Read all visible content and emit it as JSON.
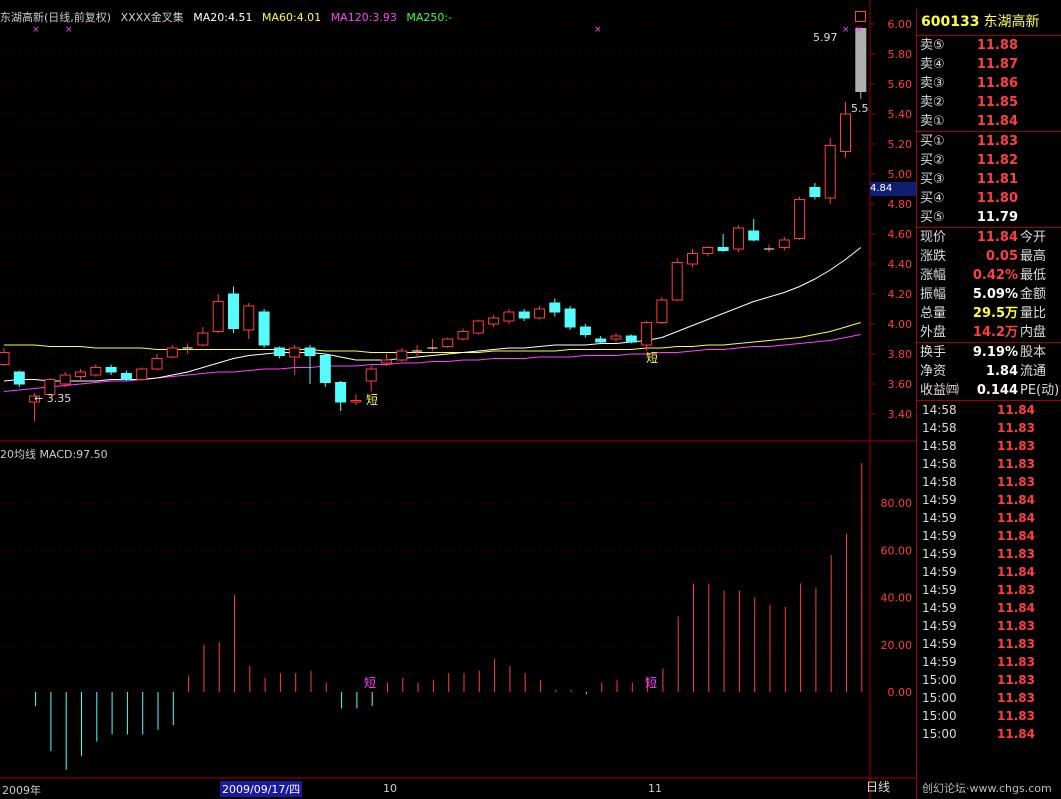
{
  "header": {
    "title": "东湖高新(日线,前复权)",
    "formula": "XXXX金叉集",
    "ma20": "MA20:4.51",
    "ma60": "MA60:4.01",
    "ma120": "MA120:3.93",
    "ma250": "MA250:-"
  },
  "indicator_title": "20均线  MACD:97.50",
  "price_axis": [
    "6.00",
    "5.80",
    "5.60",
    "5.40",
    "5.20",
    "5.00",
    "4.80",
    "4.60",
    "4.40",
    "4.20",
    "4.00",
    "3.80",
    "3.60",
    "3.40"
  ],
  "macd_axis": [
    "80.00",
    "60.00",
    "40.00",
    "20.00",
    "0.00"
  ],
  "annotations": {
    "low_label": "← 3.35",
    "high_label": "5.97",
    "right_label": "5.5",
    "short_mark": "短",
    "current_price_tag": "4.84"
  },
  "dates": {
    "year": "2009年",
    "selected": "2009/09/17/四",
    "oct": "10",
    "nov": "11"
  },
  "bottom_tab": "日线",
  "watermark": "创幻论坛·www.chgs.com",
  "quote": {
    "code": "600133",
    "name": "东湖高新",
    "asks": [
      {
        "label": "卖⑤",
        "price": "11.88"
      },
      {
        "label": "卖④",
        "price": "11.87"
      },
      {
        "label": "卖③",
        "price": "11.86"
      },
      {
        "label": "卖②",
        "price": "11.85"
      },
      {
        "label": "卖①",
        "price": "11.84"
      }
    ],
    "bids": [
      {
        "label": "买①",
        "price": "11.83"
      },
      {
        "label": "买②",
        "price": "11.82"
      },
      {
        "label": "买③",
        "price": "11.81"
      },
      {
        "label": "买④",
        "price": "11.80"
      },
      {
        "label": "买⑤",
        "price": "11.79"
      }
    ],
    "stats1": [
      {
        "label": "现价",
        "value": "11.84",
        "label2": "今开",
        "color": "red"
      },
      {
        "label": "涨跌",
        "value": "0.05",
        "label2": "最高",
        "color": "red"
      },
      {
        "label": "涨幅",
        "value": "0.42%",
        "label2": "最低",
        "color": "red"
      },
      {
        "label": "振幅",
        "value": "5.09%",
        "label2": "金额",
        "color": "white"
      },
      {
        "label": "总量",
        "value": "29.5万",
        "label2": "量比",
        "color": "yellow"
      },
      {
        "label": "外盘",
        "value": "14.2万",
        "label2": "内盘",
        "color": "red"
      }
    ],
    "stats2": [
      {
        "label": "换手",
        "value": "9.19%",
        "label2": "股本",
        "color": "white"
      },
      {
        "label": "净资",
        "value": "1.84",
        "label2": "流通",
        "color": "white"
      },
      {
        "label": "收益㈣",
        "value": "0.144",
        "label2": "PE(动)",
        "color": "white"
      }
    ],
    "ticks": [
      {
        "t": "14:58",
        "p": "11.84"
      },
      {
        "t": "14:58",
        "p": "11.83"
      },
      {
        "t": "14:58",
        "p": "11.83"
      },
      {
        "t": "14:58",
        "p": "11.83"
      },
      {
        "t": "14:58",
        "p": "11.83"
      },
      {
        "t": "14:59",
        "p": "11.84"
      },
      {
        "t": "14:59",
        "p": "11.84"
      },
      {
        "t": "14:59",
        "p": "11.84"
      },
      {
        "t": "14:59",
        "p": "11.83"
      },
      {
        "t": "14:59",
        "p": "11.84"
      },
      {
        "t": "14:59",
        "p": "11.83"
      },
      {
        "t": "14:59",
        "p": "11.84"
      },
      {
        "t": "14:59",
        "p": "11.83"
      },
      {
        "t": "14:59",
        "p": "11.83"
      },
      {
        "t": "14:59",
        "p": "11.83"
      },
      {
        "t": "15:00",
        "p": "11.83"
      },
      {
        "t": "15:00",
        "p": "11.83"
      },
      {
        "t": "15:00",
        "p": "11.83"
      },
      {
        "t": "15:00",
        "p": "11.84"
      }
    ]
  },
  "candles": [
    [
      3.73,
      3.81,
      3.72,
      3.84
    ],
    [
      3.68,
      3.6,
      3.58,
      3.69
    ],
    [
      3.48,
      3.52,
      3.35,
      3.54
    ],
    [
      3.53,
      3.63,
      3.52,
      3.64
    ],
    [
      3.6,
      3.66,
      3.58,
      3.68
    ],
    [
      3.65,
      3.68,
      3.63,
      3.7
    ],
    [
      3.66,
      3.71,
      3.65,
      3.73
    ],
    [
      3.71,
      3.68,
      3.66,
      3.73
    ],
    [
      3.67,
      3.63,
      3.62,
      3.69
    ],
    [
      3.63,
      3.7,
      3.62,
      3.71
    ],
    [
      3.7,
      3.77,
      3.69,
      3.8
    ],
    [
      3.78,
      3.84,
      3.77,
      3.86
    ],
    [
      3.84,
      3.84,
      3.8,
      3.87
    ],
    [
      3.86,
      3.94,
      3.85,
      3.98
    ],
    [
      3.95,
      4.15,
      3.94,
      4.2
    ],
    [
      4.2,
      3.97,
      3.94,
      4.25
    ],
    [
      3.96,
      4.12,
      3.9,
      4.14
    ],
    [
      4.08,
      3.86,
      3.84,
      4.1
    ],
    [
      3.84,
      3.79,
      3.77,
      3.85
    ],
    [
      3.78,
      3.84,
      3.66,
      3.86
    ],
    [
      3.84,
      3.79,
      3.6,
      3.86
    ],
    [
      3.79,
      3.61,
      3.58,
      3.8
    ],
    [
      3.61,
      3.48,
      3.42,
      3.62
    ],
    [
      3.48,
      3.49,
      3.46,
      3.53
    ],
    [
      3.62,
      3.7,
      3.55,
      3.72
    ],
    [
      3.74,
      3.76,
      3.72,
      3.8
    ],
    [
      3.76,
      3.82,
      3.75,
      3.84
    ],
    [
      3.82,
      3.82,
      3.78,
      3.86
    ],
    [
      3.84,
      3.84,
      3.82,
      3.9
    ],
    [
      3.85,
      3.9,
      3.84,
      3.91
    ],
    [
      3.9,
      3.95,
      3.89,
      3.97
    ],
    [
      3.94,
      4.02,
      3.93,
      4.03
    ],
    [
      4.0,
      4.04,
      3.98,
      4.06
    ],
    [
      4.02,
      4.08,
      4.0,
      4.1
    ],
    [
      4.08,
      4.04,
      4.02,
      4.1
    ],
    [
      4.04,
      4.1,
      4.03,
      4.12
    ],
    [
      4.14,
      4.08,
      4.05,
      4.17
    ],
    [
      4.1,
      3.98,
      3.96,
      4.12
    ],
    [
      3.98,
      3.93,
      3.91,
      4.0
    ],
    [
      3.9,
      3.88,
      3.87,
      3.92
    ],
    [
      3.9,
      3.92,
      3.88,
      3.94
    ],
    [
      3.92,
      3.88,
      3.87,
      3.93
    ],
    [
      3.86,
      4.01,
      3.82,
      4.02
    ],
    [
      4.01,
      4.16,
      4.0,
      4.18
    ],
    [
      4.16,
      4.41,
      4.15,
      4.44
    ],
    [
      4.4,
      4.47,
      4.38,
      4.5
    ],
    [
      4.47,
      4.51,
      4.45,
      4.52
    ],
    [
      4.51,
      4.49,
      4.48,
      4.6
    ],
    [
      4.5,
      4.64,
      4.48,
      4.66
    ],
    [
      4.62,
      4.56,
      4.55,
      4.7
    ],
    [
      4.5,
      4.5,
      4.48,
      4.53
    ],
    [
      4.51,
      4.56,
      4.49,
      4.58
    ],
    [
      4.57,
      4.83,
      4.56,
      4.85
    ],
    [
      4.91,
      4.85,
      4.83,
      4.94
    ],
    [
      4.84,
      5.19,
      4.8,
      5.24
    ],
    [
      5.15,
      5.4,
      5.11,
      5.48
    ],
    [
      5.97,
      5.55,
      5.5,
      5.97
    ]
  ],
  "ma_white": [
    3.62,
    3.63,
    3.63,
    3.62,
    3.62,
    3.62,
    3.62,
    3.63,
    3.63,
    3.63,
    3.64,
    3.66,
    3.68,
    3.71,
    3.74,
    3.77,
    3.79,
    3.8,
    3.81,
    3.81,
    3.81,
    3.8,
    3.78,
    3.76,
    3.76,
    3.76,
    3.77,
    3.78,
    3.79,
    3.8,
    3.81,
    3.82,
    3.83,
    3.84,
    3.84,
    3.85,
    3.86,
    3.86,
    3.86,
    3.87,
    3.87,
    3.88,
    3.89,
    3.91,
    3.95,
    3.99,
    4.03,
    4.07,
    4.11,
    4.15,
    4.18,
    4.21,
    4.25,
    4.3,
    4.36,
    4.43,
    4.51
  ],
  "ma_yellow": [
    3.86,
    3.86,
    3.86,
    3.85,
    3.85,
    3.85,
    3.84,
    3.84,
    3.84,
    3.84,
    3.83,
    3.83,
    3.83,
    3.83,
    3.83,
    3.83,
    3.83,
    3.83,
    3.83,
    3.83,
    3.83,
    3.82,
    3.82,
    3.82,
    3.81,
    3.81,
    3.81,
    3.81,
    3.81,
    3.81,
    3.81,
    3.81,
    3.82,
    3.82,
    3.82,
    3.82,
    3.82,
    3.83,
    3.83,
    3.83,
    3.83,
    3.83,
    3.84,
    3.84,
    3.85,
    3.85,
    3.86,
    3.86,
    3.87,
    3.88,
    3.89,
    3.9,
    3.91,
    3.93,
    3.95,
    3.98,
    4.01
  ],
  "ma_magenta": [
    3.55,
    3.56,
    3.57,
    3.58,
    3.59,
    3.6,
    3.61,
    3.62,
    3.62,
    3.63,
    3.64,
    3.65,
    3.66,
    3.67,
    3.68,
    3.68,
    3.69,
    3.7,
    3.7,
    3.71,
    3.71,
    3.72,
    3.72,
    3.72,
    3.73,
    3.73,
    3.74,
    3.74,
    3.75,
    3.75,
    3.76,
    3.76,
    3.77,
    3.77,
    3.77,
    3.78,
    3.78,
    3.78,
    3.79,
    3.79,
    3.79,
    3.8,
    3.8,
    3.81,
    3.81,
    3.82,
    3.83,
    3.83,
    3.84,
    3.85,
    3.85,
    3.86,
    3.87,
    3.88,
    3.89,
    3.91,
    3.93
  ],
  "macd_values": [
    -6,
    -25,
    -33,
    -27,
    -21,
    -18,
    -18,
    -18,
    -16,
    -14,
    7,
    20,
    21,
    41,
    11,
    6,
    8,
    8,
    9,
    4,
    -7,
    -7,
    -6,
    4,
    6,
    4,
    5,
    8,
    8,
    9,
    14,
    11,
    8,
    5,
    1,
    1,
    -1,
    4,
    5,
    4,
    6,
    10,
    32,
    46,
    46,
    43,
    43,
    40,
    37,
    36,
    46,
    44,
    58,
    67,
    97
  ]
}
